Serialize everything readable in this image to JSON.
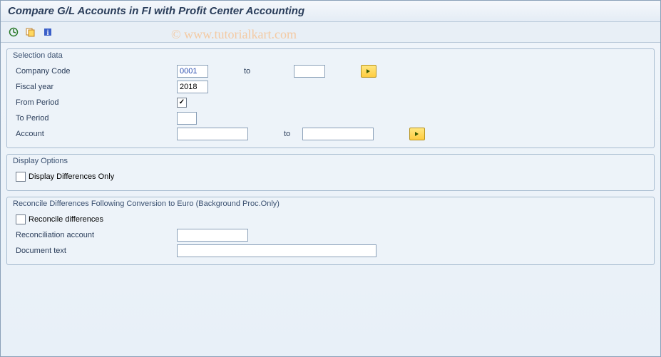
{
  "window": {
    "title": "Compare G/L Accounts in FI with Profit Center Accounting"
  },
  "watermark": "© www.tutorialkart.com",
  "groups": {
    "selection": {
      "title": "Selection data",
      "company_code_label": "Company Code",
      "company_code_value": "0001",
      "company_code_to_label": "to",
      "company_code_to_value": "",
      "fiscal_year_label": "Fiscal year",
      "fiscal_year_value": "2018",
      "from_period_label": "From Period",
      "from_period_checked": true,
      "to_period_label": "To Period",
      "to_period_value": "",
      "account_label": "Account",
      "account_value": "",
      "account_to_label": "to",
      "account_to_value": ""
    },
    "display": {
      "title": "Display Options",
      "diff_only_label": "Display Differences Only",
      "diff_only_checked": false
    },
    "reconcile": {
      "title": "Reconcile Differences Following Conversion to Euro (Background Proc.Only)",
      "reconcile_label": "Reconcile differences",
      "reconcile_checked": false,
      "reconcile_acct_label": "Reconciliation account",
      "reconcile_acct_value": "",
      "doc_text_label": "Document text",
      "doc_text_value": ""
    }
  }
}
